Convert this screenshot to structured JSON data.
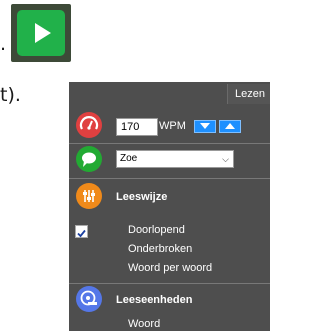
{
  "background_text": {
    "line1": ".",
    "line2": "t)."
  },
  "panel": {
    "tab_label": "Lezen",
    "speed": {
      "icon": "speedometer-icon",
      "value": "170",
      "unit": "WPM",
      "decrease_icon": "arrow-down-icon",
      "increase_icon": "arrow-up-icon"
    },
    "voice": {
      "icon": "speech-bubble-icon",
      "selected": "Zoe"
    },
    "reading_mode": {
      "icon": "equalizer-icon",
      "title": "Leeswijze",
      "options": [
        "Doorlopend",
        "Onderbroken",
        "Woord per woord"
      ],
      "selected_index": 0
    },
    "reading_units": {
      "icon": "measuring-tape-icon",
      "title": "Leeseenheden",
      "options": [
        "Woord"
      ]
    }
  },
  "colors": {
    "play_green": "#21b14a",
    "panel_bg": "#4e4e4e",
    "speed_red": "#e04040",
    "voice_green": "#22aa33",
    "mode_orange": "#f08a1a",
    "units_blue": "#5577e8",
    "arrow_blue": "#1e90ff"
  }
}
